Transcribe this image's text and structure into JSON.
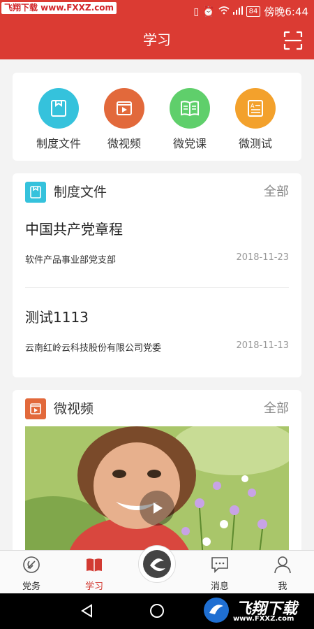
{
  "statusbar": {
    "watermark": "飞翔下载 www.FXXZ.com",
    "battery": "84",
    "carrier_time": "傍晚6:44"
  },
  "header": {
    "title": "学习"
  },
  "quick_links": [
    {
      "label": "制度文件",
      "color": "#35c2dc",
      "icon": "document-icon"
    },
    {
      "label": "微视频",
      "color": "#e2693b",
      "icon": "video-icon"
    },
    {
      "label": "微党课",
      "color": "#5fcf6b",
      "icon": "book-icon"
    },
    {
      "label": "微测试",
      "color": "#f3a12c",
      "icon": "quiz-icon"
    }
  ],
  "documents_section": {
    "title": "制度文件",
    "more": "全部",
    "icon_color": "#35c2dc",
    "items": [
      {
        "title": "中国共产党章程",
        "org": "软件产品事业部党支部",
        "date": "2018-11-23"
      },
      {
        "title": "测试1113",
        "org": "云南红岭云科技股份有限公司党委",
        "date": "2018-11-13"
      }
    ]
  },
  "video_section": {
    "title": "微视频",
    "more": "全部",
    "icon_color": "#e2693b"
  },
  "tabbar": {
    "items": [
      {
        "label": "党务",
        "active": false
      },
      {
        "label": "学习",
        "active": true
      },
      {
        "label": "",
        "active": false
      },
      {
        "label": "消息",
        "active": false
      },
      {
        "label": "我",
        "active": false
      }
    ],
    "accent": "#d23a32"
  },
  "bottom_watermark": {
    "text": "飞翔下载",
    "url": "www.FXXZ.com"
  }
}
